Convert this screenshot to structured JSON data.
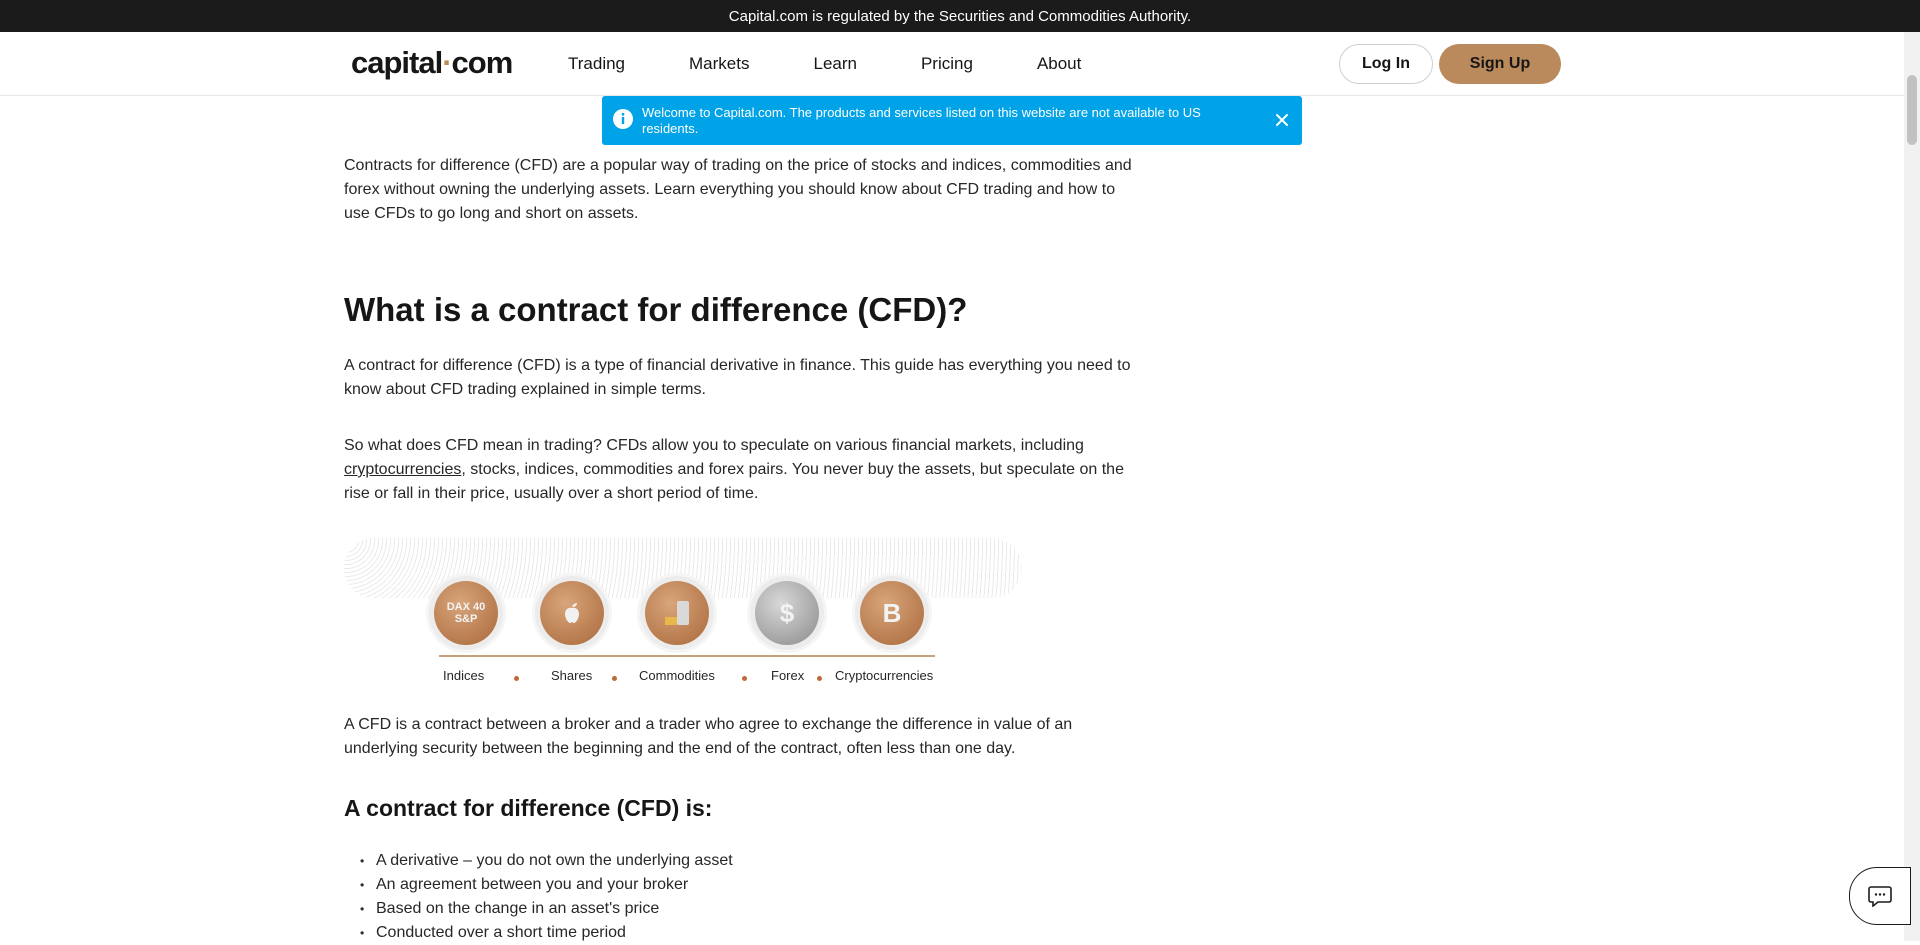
{
  "topbar": {
    "text": "Capital.com is regulated by the Securities and Commodities Authority."
  },
  "header": {
    "logo_left": "capital",
    "logo_dot": "·",
    "logo_right": "com",
    "nav": [
      "Trading",
      "Markets",
      "Learn",
      "Pricing",
      "About"
    ],
    "login_label": "Log In",
    "signup_label": "Sign Up"
  },
  "banner": {
    "text": "Welcome to Capital.com. The products and services listed on this website are not available to US residents.",
    "icon": "info-icon",
    "close_icon": "close-icon"
  },
  "article": {
    "intro": "Contracts for difference (CFD) are a popular way of trading on the price of stocks and indices, commodities and forex without owning the underlying assets. Learn everything you should know about CFD trading and how to use CFDs to go long and short on assets.",
    "heading": "What is a contract for difference (CFD)?",
    "para1": "A contract for difference (CFD) is a type of financial derivative in finance. This guide has everything you need to know about CFD trading explained in simple terms.",
    "para2_before": "So what does CFD mean in trading? CFDs allow you to speculate on various financial markets, including ",
    "para2_link": "cryptocurrencies",
    "para2_after": ", stocks, indices, commodities and forex pairs. You never buy the assets, but speculate on the rise or fall in their price, usually over a short period of time.",
    "illustration": {
      "items": [
        {
          "label": "Indices",
          "icon_text": "DAX 40 S&P"
        },
        {
          "label": "Shares",
          "icon_text": ""
        },
        {
          "label": "Commodities",
          "icon_text": ""
        },
        {
          "label": "Forex",
          "icon_text": "$"
        },
        {
          "label": "Cryptocurrencies",
          "icon_text": "B"
        }
      ]
    },
    "para3": "A CFD is a contract between a broker and a trader who agree to exchange the difference in value of an underlying security between the beginning and the end of the contract, often less than one day.",
    "subheading": "A contract for difference (CFD) is:",
    "bullets": [
      "A derivative – you do not own the underlying asset",
      "An agreement between you and your broker",
      "Based on the change in an asset's price",
      "Conducted over a short time period"
    ]
  },
  "colors": {
    "accent": "#bb8a5c",
    "banner": "#00a3e8",
    "topbar": "#1b1b1b"
  },
  "chat": {
    "icon": "chat-icon"
  }
}
